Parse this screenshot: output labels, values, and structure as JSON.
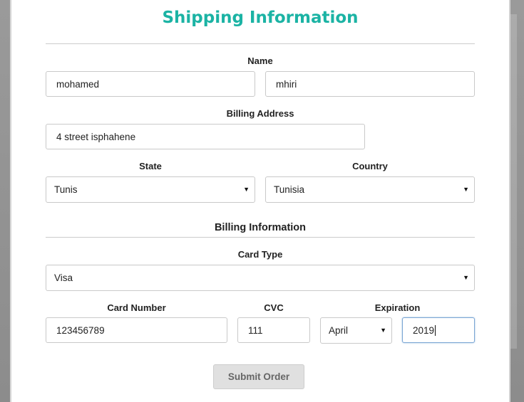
{
  "form": {
    "title": "Shipping Information",
    "name_label": "Name",
    "first_name": "mohamed",
    "last_name": "mhiri",
    "billing_address_label": "Billing Address",
    "billing_address": "4 street isphahene",
    "state_label": "State",
    "state_value": "Tunis",
    "country_label": "Country",
    "country_value": "Tunisia",
    "billing_info_heading": "Billing Information",
    "card_type_label": "Card Type",
    "card_type_value": "Visa",
    "card_number_label": "Card Number",
    "card_number": "123456789",
    "cvc_label": "CVC",
    "cvc": "111",
    "expiration_label": "Expiration",
    "expiration_month": "April",
    "expiration_year": "2019",
    "submit_label": "Submit Order"
  },
  "icons": {
    "dropdown": "caret-down-icon"
  },
  "colors": {
    "title": "#1bb3a4",
    "submit_bg": "#e0e0e0",
    "focus_border": "#7aa6d4"
  }
}
